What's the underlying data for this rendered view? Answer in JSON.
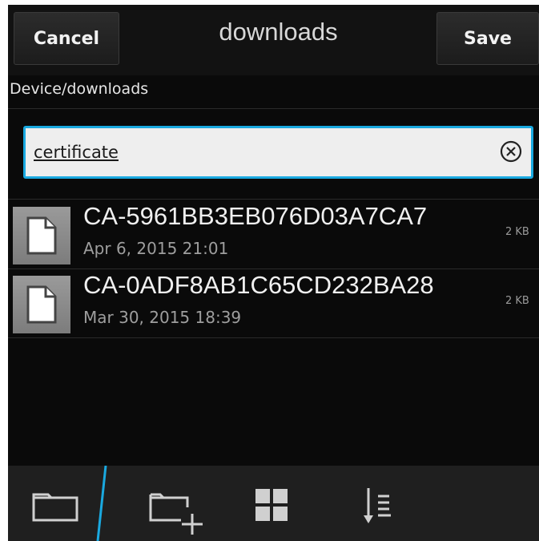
{
  "titlebar": {
    "cancel_label": "Cancel",
    "title": "downloads",
    "save_label": "Save"
  },
  "path": "Device/downloads",
  "search": {
    "value": "certificate",
    "clear_icon": "clear-circle-x-icon"
  },
  "files": [
    {
      "name": "CA-5961BB3EB076D03A7CA7",
      "date": "Apr 6, 2015 21:01",
      "size": "2 KB",
      "icon": "document-icon"
    },
    {
      "name": "CA-0ADF8AB1C65CD232BA28",
      "date": "Mar 30, 2015 18:39",
      "size": "2 KB",
      "icon": "document-icon"
    }
  ],
  "actionbar": {
    "items": [
      {
        "icon": "folder-icon"
      },
      {
        "icon": "new-folder-icon"
      },
      {
        "icon": "grid-view-icon"
      },
      {
        "icon": "sort-icon"
      }
    ]
  },
  "colors": {
    "accent": "#1aa9e0",
    "background": "#0a0a0a",
    "actionbar": "#1f1f1f"
  }
}
